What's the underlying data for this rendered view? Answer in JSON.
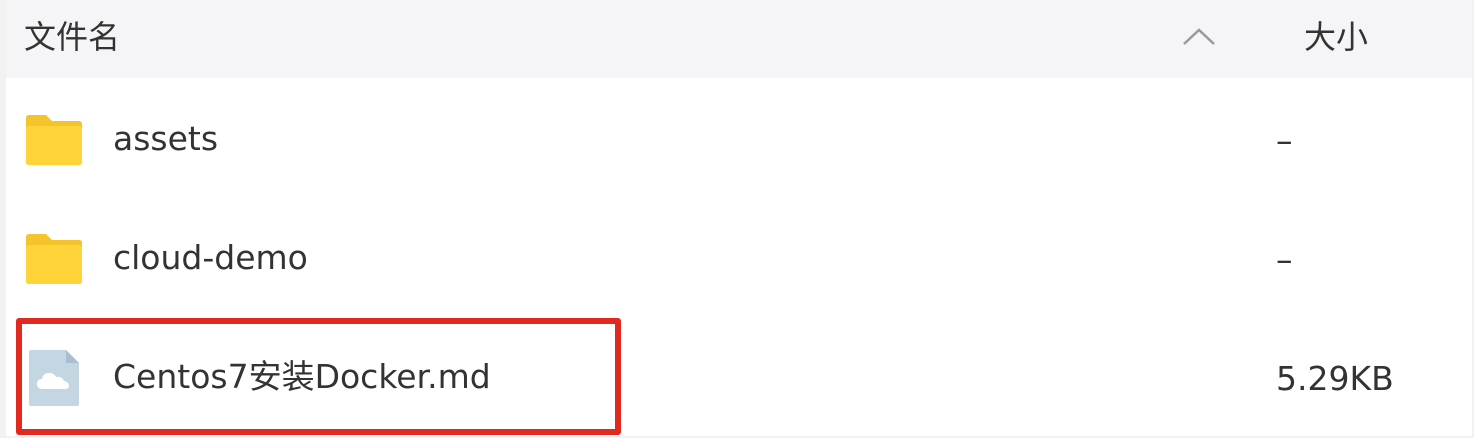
{
  "header": {
    "name_label": "文件名",
    "size_label": "大小",
    "sort_icon": "chevron-up-icon"
  },
  "rows": [
    {
      "name": "assets",
      "size": "–",
      "icon": "folder-icon"
    },
    {
      "name": "cloud-demo",
      "size": "–",
      "icon": "folder-icon"
    },
    {
      "name": "Centos7安装Docker.md",
      "size": "5.29KB",
      "icon": "cloud-file-icon"
    }
  ],
  "colors": {
    "folder": "#ffd43b",
    "folder_tab": "#f5c32b",
    "file_icon": "#c5d6e3",
    "highlight": "#e02a20"
  }
}
